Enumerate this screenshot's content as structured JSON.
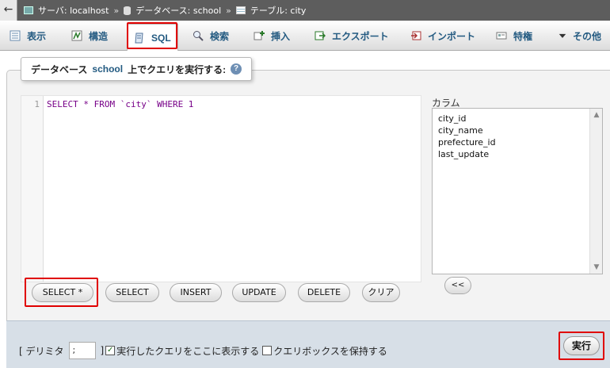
{
  "breadcrumb": {
    "back": "←",
    "server": "サーバ: localhost",
    "database": "データベース: school",
    "table": "テーブル: city",
    "sep": "»"
  },
  "tabs": [
    {
      "label": "表示",
      "icon": "browse-icon"
    },
    {
      "label": "構造",
      "icon": "structure-icon"
    },
    {
      "label": "SQL",
      "icon": "sql-icon",
      "active": true
    },
    {
      "label": "検索",
      "icon": "search-icon"
    },
    {
      "label": "挿入",
      "icon": "insert-icon"
    },
    {
      "label": "エクスポート",
      "icon": "export-icon"
    },
    {
      "label": "インポート",
      "icon": "import-icon"
    },
    {
      "label": "特権",
      "icon": "privileges-icon"
    },
    {
      "label": "その他",
      "icon": "more-icon"
    }
  ],
  "query": {
    "legend_prefix": "データベース",
    "database": "school",
    "legend_suffix": "上でクエリを実行する:",
    "help_glyph": "?",
    "line_number": "1",
    "sql": "SELECT * FROM `city` WHERE 1"
  },
  "columns": {
    "label": "カラム",
    "items": [
      "city_id",
      "city_name",
      "prefecture_id",
      "last_update"
    ],
    "insert_button": "<<"
  },
  "sql_buttons": [
    "SELECT *",
    "SELECT",
    "INSERT",
    "UPDATE",
    "DELETE",
    "クリア"
  ],
  "footer": {
    "delimiter_label_open": "[ デリミタ",
    "delimiter_value": ";",
    "delimiter_label_close": "]",
    "show_query_label": "実行したクエリをここに表示する",
    "show_query_checked": true,
    "retain_box_label": "クエリボックスを保持する",
    "retain_box_checked": false,
    "go_button": "実行"
  },
  "colors": {
    "highlight": "#e00000",
    "link": "#235a81"
  }
}
